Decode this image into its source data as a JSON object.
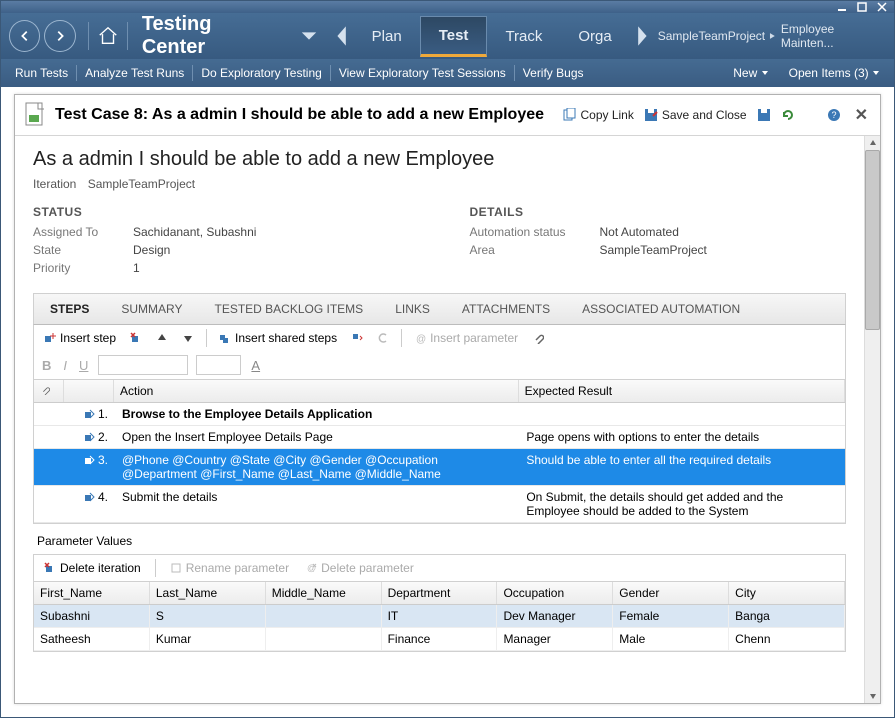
{
  "window_controls": {
    "min": "_",
    "max": "□",
    "close": "×"
  },
  "nav": {
    "center_title": "Testing Center",
    "main_tabs": [
      "Plan",
      "Test",
      "Track",
      "Orga"
    ],
    "active_tab_index": 1,
    "breadcrumb": [
      "SampleTeamProject",
      "Employee Mainten..."
    ],
    "sub_items": [
      "Run Tests",
      "Analyze Test Runs",
      "Do Exploratory Testing",
      "View Exploratory Test Sessions",
      "Verify Bugs"
    ],
    "new_label": "New",
    "open_items_label": "Open Items (3)"
  },
  "page": {
    "title": "Test Case 8: As a admin I should be able to add a new Employee",
    "actions": {
      "copy_link": "Copy Link",
      "save_close": "Save and Close"
    },
    "h1": "As a admin I should be able to add a new Employee",
    "iteration_label": "Iteration",
    "iteration_value": "SampleTeamProject",
    "status_head": "STATUS",
    "details_head": "DETAILS",
    "status": {
      "assigned_to_label": "Assigned To",
      "assigned_to": "Sachidanant, Subashni",
      "state_label": "State",
      "state": "Design",
      "priority_label": "Priority",
      "priority": "1"
    },
    "details": {
      "auto_label": "Automation status",
      "auto": "Not Automated",
      "area_label": "Area",
      "area": "SampleTeamProject"
    },
    "tabs2": [
      "STEPS",
      "SUMMARY",
      "TESTED BACKLOG ITEMS",
      "LINKS",
      "ATTACHMENTS",
      "ASSOCIATED AUTOMATION"
    ],
    "tabs2_active": 0,
    "steps_toolbar": {
      "insert_step": "Insert step",
      "insert_shared": "Insert shared steps",
      "insert_param": "Insert parameter"
    },
    "steps_head": {
      "action": "Action",
      "expected": "Expected Result"
    },
    "steps": [
      {
        "num": "1.",
        "action": "Browse to the Employee Details Application",
        "expected": "",
        "bold": true
      },
      {
        "num": "2.",
        "action": "Open the Insert Employee Details Page",
        "expected": "Page opens with options to enter the details"
      },
      {
        "num": "3.",
        "action": "@Phone @Country @State @City @Gender @Occupation @Department @First_Name @Last_Name @Middle_Name",
        "expected": "Should be able to enter all the required details",
        "selected": true
      },
      {
        "num": "4.",
        "action": "Submit the details",
        "expected": "On Submit, the details should get added and the Employee should be added to the System"
      }
    ],
    "param_values_label": "Parameter Values",
    "param_toolbar": {
      "delete_iter": "Delete iteration",
      "rename": "Rename parameter",
      "delete_param": "Delete parameter"
    },
    "param_cols": [
      "First_Name",
      "Last_Name",
      "Middle_Name",
      "Department",
      "Occupation",
      "Gender",
      "City"
    ],
    "param_rows": [
      {
        "sel": true,
        "cells": [
          "Subashni",
          "S",
          "",
          "IT",
          "Dev Manager",
          "Female",
          "Banga"
        ]
      },
      {
        "cells": [
          "Satheesh",
          "Kumar",
          "",
          "Finance",
          "Manager",
          "Male",
          "Chenn"
        ]
      }
    ]
  }
}
